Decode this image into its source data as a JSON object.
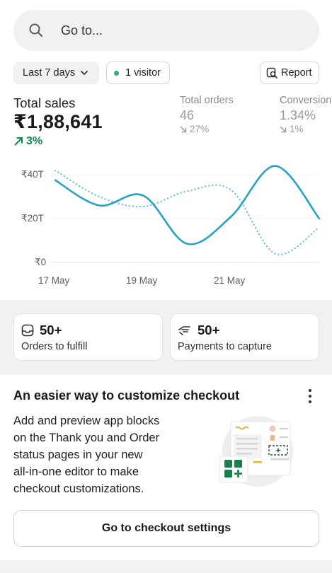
{
  "search": {
    "placeholder": "Go to..."
  },
  "filters": {
    "date_range": "Last 7 days",
    "visitors": "1 visitor",
    "report_label": "Report"
  },
  "metrics": {
    "total_sales": {
      "label": "Total sales",
      "value": "₹1,88,641",
      "change": "3%"
    },
    "total_orders": {
      "label": "Total orders",
      "value": "46",
      "change": "27%"
    },
    "conversion": {
      "label": "Conversion",
      "value": "1.34%",
      "change": "1%"
    }
  },
  "chart_data": {
    "type": "line",
    "x_ticks": [
      "17 May",
      "19 May",
      "21 May"
    ],
    "y_ticks": [
      "₹40T",
      "₹20T",
      "₹0"
    ],
    "ylim": [
      0,
      40
    ],
    "grid": true,
    "legend": "none",
    "series": [
      {
        "style": "solid",
        "color": "#27a1c8",
        "values": [
          37.5,
          26,
          30.5,
          8.5,
          21,
          44,
          20
        ]
      },
      {
        "style": "dotted",
        "color": "#5fc0c3",
        "values": [
          42,
          30,
          25.5,
          32.5,
          33,
          4,
          16
        ]
      }
    ]
  },
  "tasks": [
    {
      "count": "50+",
      "label": "Orders to fulfill",
      "icon": "inbox-icon"
    },
    {
      "count": "50+",
      "label": "Payments to capture",
      "icon": "hand-payment-icon"
    }
  ],
  "promo": {
    "title": "An easier way to customize checkout",
    "body_lines": [
      "Add and preview app blocks",
      "on the Thank you and Order",
      "status pages in your new",
      "all-in-one editor to make",
      "checkout customizations."
    ],
    "cta_label": "Go to checkout settings"
  },
  "colors": {
    "accent_green": "#0f8a4f",
    "line_solid": "#27a1c8",
    "line_dotted": "#5fc0c3"
  }
}
